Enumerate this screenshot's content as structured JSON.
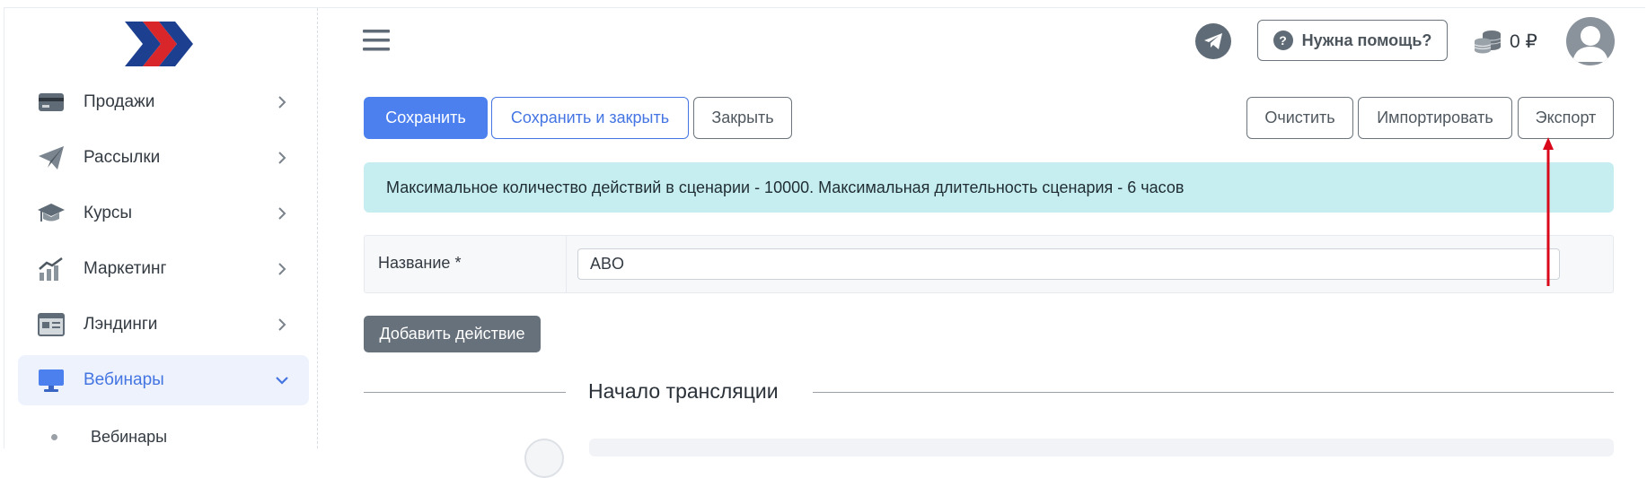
{
  "sidebar": {
    "items": [
      {
        "label": "Продажи",
        "icon": "wallet-icon"
      },
      {
        "label": "Рассылки",
        "icon": "paper-plane-icon"
      },
      {
        "label": "Курсы",
        "icon": "graduation-cap-icon"
      },
      {
        "label": "Маркетинг",
        "icon": "chart-icon"
      },
      {
        "label": "Лэндинги",
        "icon": "landing-page-icon"
      },
      {
        "label": "Вебинары",
        "icon": "monitor-icon"
      }
    ],
    "sub_items": [
      {
        "label": "Вебинары"
      }
    ]
  },
  "header": {
    "help_label": "Нужна помощь?",
    "help_icon_glyph": "?",
    "balance": "0 ₽"
  },
  "toolbar": {
    "save_label": "Сохранить",
    "save_close_label": "Сохранить и закрыть",
    "close_label": "Закрыть",
    "clear_label": "Очистить",
    "import_label": "Импортировать",
    "export_label": "Экспорт"
  },
  "alert": {
    "text": "Максимальное количество действий в сценарии - 10000. Максимальная длительность сценария - 6 часов"
  },
  "form": {
    "name_label": "Название *",
    "name_value": "ABO"
  },
  "actions": {
    "add_action_label": "Добавить действие"
  },
  "section": {
    "title": "Начало трансляции"
  },
  "colors": {
    "primary": "#4c80ef",
    "secondary": "#67717b",
    "alert_bg": "#c6eef1",
    "active_nav_bg": "#edf2fc",
    "annotation_arrow": "#d9091b"
  }
}
